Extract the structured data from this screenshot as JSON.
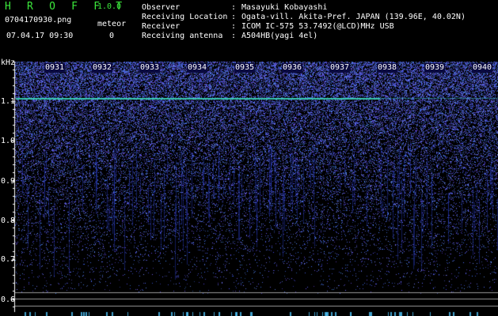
{
  "app": {
    "brand": "H R O F F T",
    "version": "1.0.0"
  },
  "file": {
    "filename": "0704170930.png",
    "datetime": "07.04.17 09:30"
  },
  "meteor": {
    "label": "meteor",
    "count": "0"
  },
  "info": [
    {
      "label": "Observer",
      "sep": ":",
      "value": "Masayuki Kobayashi"
    },
    {
      "label": "Receiving Location",
      "sep": ":",
      "value": "Ogata-vill. Akita-Pref. JAPAN (139.96E, 40.02N)"
    },
    {
      "label": "Receiver",
      "sep": ":",
      "value": "ICOM IC-575 53.7492(@LCD)MHz USB"
    },
    {
      "label": "Receiving antenna",
      "sep": ":",
      "value": "A504HB(yagi 4el)"
    }
  ],
  "axis": {
    "unit": "kHz",
    "y_ticks": [
      {
        "label": "1.1",
        "value": 1.1
      },
      {
        "label": "1.0",
        "value": 1.0
      },
      {
        "label": "0.9",
        "value": 0.9
      },
      {
        "label": "0.8",
        "value": 0.8
      },
      {
        "label": "0.7",
        "value": 0.7
      },
      {
        "label": "0.6",
        "value": 0.6
      }
    ],
    "x_ticks": [
      "0931",
      "0932",
      "0933",
      "0934",
      "0935",
      "0936",
      "0937",
      "0938",
      "0939",
      "0940"
    ]
  },
  "colors": {
    "background": "#000000",
    "brand": "#3ce83c",
    "noise": "#2a3cff",
    "signal": "#3fe0c0",
    "text": "#ffffff"
  }
}
